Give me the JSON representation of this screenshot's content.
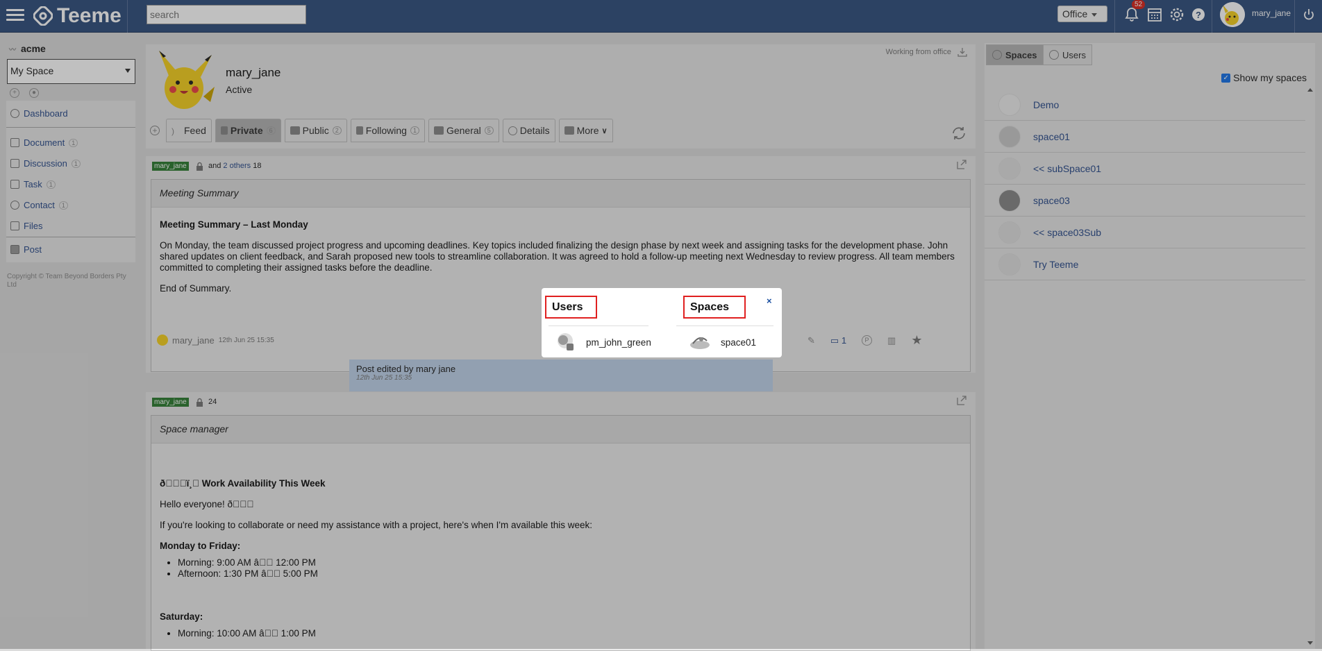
{
  "app": {
    "name": "Teeme",
    "search_placeholder": "search",
    "office_label": "Office",
    "notif_count": "52",
    "username": "mary_jane"
  },
  "sidebar": {
    "org": "acme",
    "space_select": "My Space",
    "items": [
      {
        "label": "Dashboard",
        "icon": "dashboard-icon",
        "count": ""
      },
      {
        "label": "Document",
        "icon": "document-icon",
        "count": "1"
      },
      {
        "label": "Discussion",
        "icon": "discussion-icon",
        "count": "1"
      },
      {
        "label": "Task",
        "icon": "task-icon",
        "count": "1"
      },
      {
        "label": "Contact",
        "icon": "contact-icon",
        "count": "1"
      },
      {
        "label": "Files",
        "icon": "folder-icon",
        "count": ""
      },
      {
        "label": "Post",
        "icon": "post-icon",
        "count": ""
      }
    ],
    "copyright": "Copyright © Team Beyond Borders Pty Ltd"
  },
  "profile": {
    "name": "mary_jane",
    "status": "Active",
    "working_from": "Working from office",
    "tabs": [
      {
        "label": "Feed",
        "count": ""
      },
      {
        "label": "Private",
        "count": "6"
      },
      {
        "label": "Public",
        "count": "2"
      },
      {
        "label": "Following",
        "count": "1"
      },
      {
        "label": "General",
        "count": "5"
      },
      {
        "label": "Details",
        "count": ""
      },
      {
        "label": "More",
        "count": ""
      }
    ]
  },
  "post1": {
    "tag": "mary_jane",
    "and": "and",
    "others": "2 others",
    "num": "18",
    "subject": "Meeting Summary",
    "heading": "Meeting Summary – Last Monday",
    "body": "On Monday, the team discussed project progress and upcoming deadlines. Key topics included finalizing the design phase by next week and assigning tasks for the development phase. John shared updates on client feedback, and Sarah proposed new tools to streamline collaboration. It was agreed to hold a follow-up meeting next Wednesday to review progress. All team members committed to completing their assigned tasks before the deadline.",
    "end": "End of Summary.",
    "author": "mary_jane",
    "date": "12th Jun 25 15:35",
    "comment_count": "1",
    "edited": "Post edited by mary jane",
    "edited_date": "12th Jun 25 15:35"
  },
  "post2": {
    "tag": "mary_jane",
    "num": "24",
    "subject": "Space manager",
    "heading": "ð\u0000\u0000\u0000ï¸\u0000 Work Availability This Week",
    "hello": "Hello everyone! ð\u0000\u0000\u0000",
    "intro": "If you're looking to collaborate or need my assistance with a project, here's when I'm available this week:",
    "mf_heading": "Monday to Friday:",
    "mf_items": [
      "Morning: 9:00 AM â\u0000\u0000 12:00 PM",
      "Afternoon: 1:30 PM â\u0000\u0000 5:00 PM"
    ],
    "sat_heading": "Saturday:",
    "sat_items": [
      "Morning: 10:00 AM â\u0000\u0000 1:00 PM"
    ]
  },
  "right_panel": {
    "tab_spaces": "Spaces",
    "tab_users": "Users",
    "show_my_spaces": "Show my spaces",
    "spaces": [
      "Demo",
      "space01",
      "<< subSpace01",
      "space03",
      "<< space03Sub",
      "Try Teeme"
    ]
  },
  "popup": {
    "users_heading": "Users",
    "spaces_heading": "Spaces",
    "close": "×",
    "user": "pm_john_green",
    "space": "space01"
  }
}
